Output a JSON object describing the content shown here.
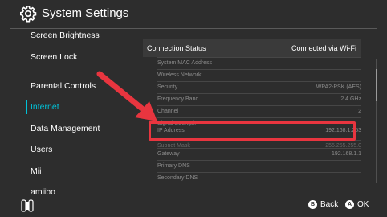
{
  "header": {
    "title": "System Settings",
    "icon": "gear-icon"
  },
  "sidebar": {
    "items": [
      {
        "label": "Screen Brightness"
      },
      {
        "label": "Screen Lock"
      },
      {
        "label": "Parental Controls"
      },
      {
        "label": "Internet"
      },
      {
        "label": "Data Management"
      },
      {
        "label": "Users"
      },
      {
        "label": "Mii"
      },
      {
        "label": "amiibo"
      }
    ],
    "selected": "Internet"
  },
  "connection": {
    "status_label": "Connection Status",
    "status_value": "Connected via Wi-Fi",
    "rows": [
      {
        "key": "System MAC Address",
        "value": ""
      },
      {
        "key": "Wireless Network",
        "value": ""
      },
      {
        "key": "Security",
        "value": "WPA2-PSK (AES)"
      },
      {
        "key": "Frequency Band",
        "value": "2.4 GHz"
      },
      {
        "key": "Channel",
        "value": "2"
      },
      {
        "key": "Signal Strength",
        "value": ""
      },
      {
        "key": "IP Address",
        "value": "192.168.1.253"
      },
      {
        "key": "Subnet Mask",
        "value": "255.255.255.0"
      },
      {
        "key": "Gateway",
        "value": "192.168.1.1"
      },
      {
        "key": "Primary DNS",
        "value": ""
      },
      {
        "key": "Secondary DNS",
        "value": ""
      }
    ]
  },
  "footer": {
    "back_label": "Back",
    "back_key": "B",
    "ok_label": "OK",
    "ok_key": "A"
  },
  "colors": {
    "accent": "#00c2d8",
    "annotation": "#e8353f",
    "background": "#2d2d2d"
  }
}
